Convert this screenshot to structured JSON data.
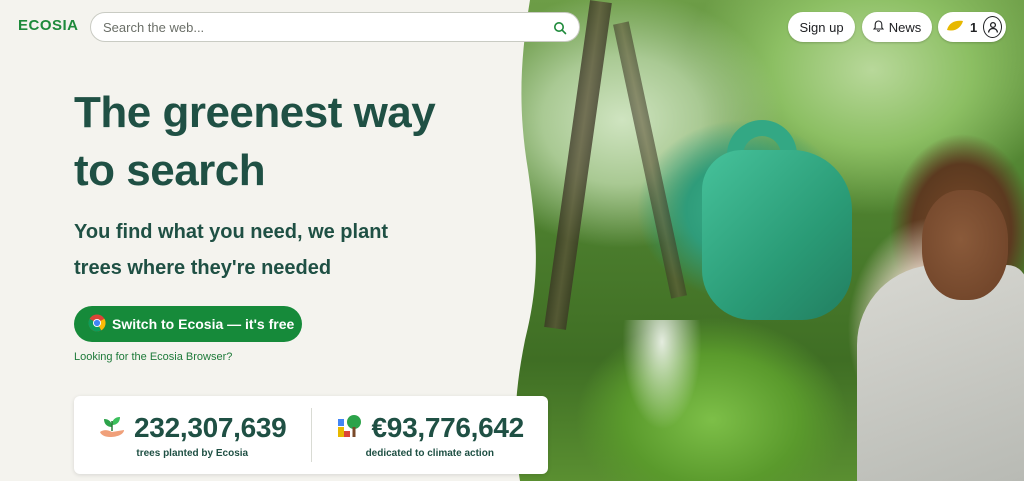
{
  "header": {
    "logo_text": "ECOSIA",
    "search_placeholder": "Search the web...",
    "signup_label": "Sign up",
    "news_label": "News",
    "tree_count": "1"
  },
  "hero": {
    "title_line1": "The greenest way",
    "title_line2": "to search",
    "subtitle_line1": "You find what you need, we plant",
    "subtitle_line2": "trees where they're needed",
    "cta_label": "Switch to Ecosia — it's free",
    "browser_link": "Looking for the Ecosia Browser?"
  },
  "stats": {
    "trees_value": "232,307,639",
    "trees_caption": "trees planted by Ecosia",
    "money_value": "€93,776,642",
    "money_caption": "dedicated to climate action"
  },
  "colors": {
    "brand_green": "#168a3a",
    "heading_green": "#1f5044",
    "background": "#f4f3ee"
  },
  "icons": [
    "search-icon",
    "bell-icon",
    "leaf-icon",
    "user-icon",
    "chrome-icon",
    "sprout-icon",
    "tree-blocks-icon"
  ]
}
